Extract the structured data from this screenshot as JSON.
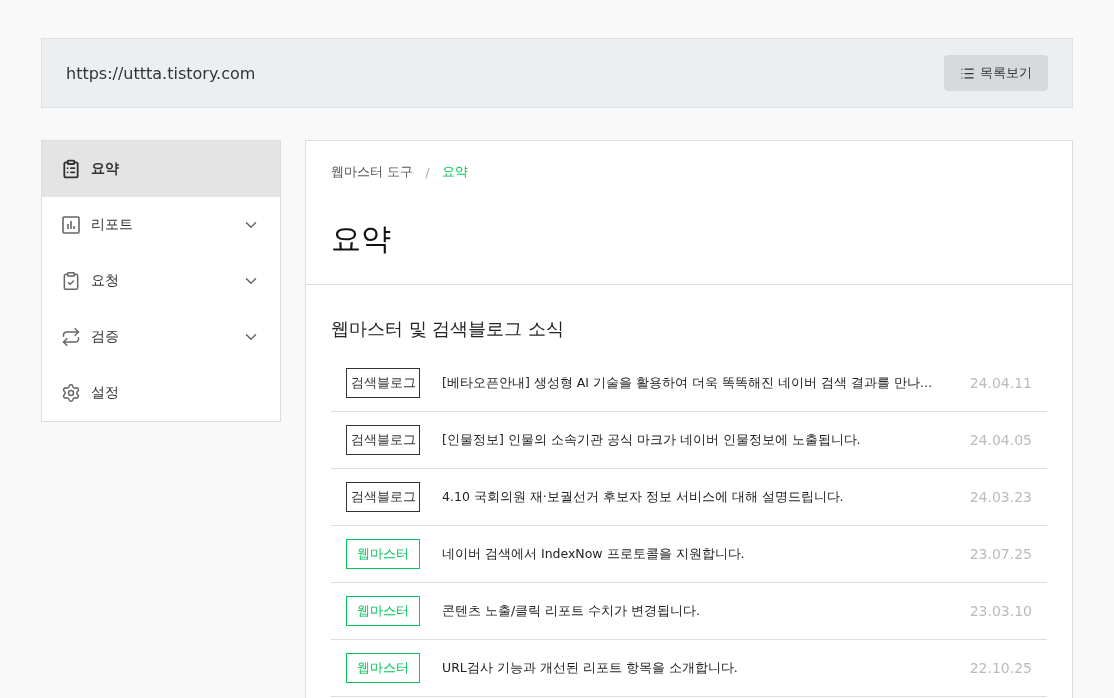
{
  "site_bar": {
    "url": "https://uttta.tistory.com",
    "list_button": "목록보기"
  },
  "sidebar": {
    "items": [
      {
        "label": "요약",
        "selected": true,
        "expandable": false
      },
      {
        "label": "리포트",
        "selected": false,
        "expandable": true
      },
      {
        "label": "요청",
        "selected": false,
        "expandable": true
      },
      {
        "label": "검증",
        "selected": false,
        "expandable": true
      },
      {
        "label": "설정",
        "selected": false,
        "expandable": false
      }
    ]
  },
  "breadcrumb": [
    {
      "label": "웹마스터 도구",
      "selected": false
    },
    {
      "label": "요약",
      "selected": true
    }
  ],
  "breadcrumb_separator": "/",
  "page_title": "요약",
  "news": {
    "title": "웹마스터 및 검색블로그 소식",
    "items": [
      {
        "kind": "blog",
        "tag": "검색블로그",
        "title": "[베타오픈안내] 생성형 AI 기술을 활용하여 더욱 똑똑해진 네이버 검색 결과를 만나…",
        "date": "24.04.11"
      },
      {
        "kind": "blog",
        "tag": "검색블로그",
        "title": "[인물정보] 인물의 소속기관 공식 마크가 네이버 인물정보에 노출됩니다.",
        "date": "24.04.05"
      },
      {
        "kind": "blog",
        "tag": "검색블로그",
        "title": "4.10 국회의원 재·보궐선거 후보자 정보 서비스에 대해 설명드립니다.",
        "date": "24.03.23"
      },
      {
        "kind": "webmaster",
        "tag": "웹마스터",
        "title": "네이버 검색에서 IndexNow 프로토콜을 지원합니다.",
        "date": "23.07.25"
      },
      {
        "kind": "webmaster",
        "tag": "웹마스터",
        "title": "콘텐츠 노출/클릭 리포트 수치가 변경됩니다.",
        "date": "23.03.10"
      },
      {
        "kind": "webmaster",
        "tag": "웹마스터",
        "title": "URL검사 기능과 개선된 리포트 항목을 소개합니다.",
        "date": "22.10.25"
      }
    ]
  }
}
